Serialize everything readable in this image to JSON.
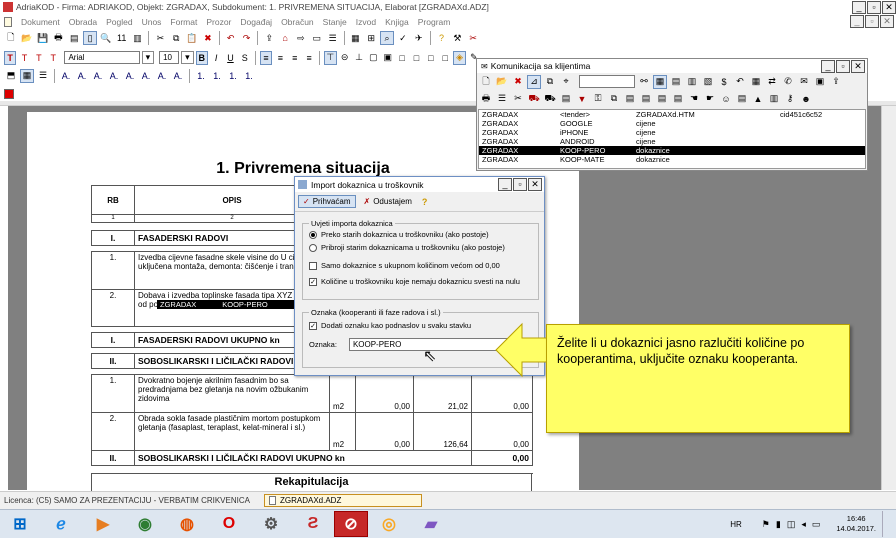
{
  "title": "AdriaKOD - Firma: ADRIAKOD,  Objekt: ZGRADAX,  Subdokument: 1. PRIVREMENA SITUACIJA,  Elaborat [ZGRADAXd.ADZ]",
  "menu": [
    "Dokument",
    "Obrada",
    "Pogled",
    "Unos",
    "Format",
    "Prozor",
    "Događaj",
    "Obračun",
    "Stanje",
    "Izvod",
    "Knjiga",
    "Program"
  ],
  "format": {
    "font": "Arial",
    "size": "10"
  },
  "doc": {
    "title": "1. Privremena situacija",
    "hdr": {
      "rb": "RB",
      "opis": "OPIS",
      "c1": "1",
      "c2": "2"
    },
    "s1": {
      "rb": "I.",
      "label": "FASADERSKI RADOVI"
    },
    "i1": {
      "rb": "1.",
      "text": "Izvedba cijevne fasadne skele visine do U cijenu uključena montaža, demonta: čišćenje i transport."
    },
    "i2": {
      "rb": "2.",
      "text": "Dobava i izvedba toplinske fasada tipa XYZ d=5 cm, od poliest. ploča EPS te privrušcice poliamidne",
      "ov1": "ZGRADAX",
      "ov2": "KOOP-PERO"
    },
    "t1": {
      "rb": "I.",
      "label": "FASADERSKI RADOVI UKUPNO kn"
    },
    "s2": {
      "rb": "II.",
      "label": "SOBOSLIKARSKI I LIČILAČKI RADOVI"
    },
    "i3": {
      "rb": "1.",
      "text": "Dvokratno bojenje akrilnim fasadnim bo sa predradnjama bez gletanja na novim ožbukanim zidovima",
      "unit": "m2",
      "a": "0,00",
      "b": "21,02",
      "c": "0,00"
    },
    "i4": {
      "rb": "2.",
      "text": "Obrada sokla fasade plastičnim mortom postupkom gletanja (fasaplast, teraplast, kelat-mineral i sl.)",
      "unit": "m2",
      "a": "0,00",
      "b": "126,64",
      "c": "0,00"
    },
    "t2": {
      "rb": "II.",
      "label": "SOBOSLIKARSKI I LIČILAČKI RADOVI UKUPNO kn",
      "total": "0,00"
    },
    "next": "Rekapitulacija"
  },
  "komm": {
    "title": "Komunikacija sa klijentima",
    "rows": [
      {
        "a": "ZGRADAX",
        "b": "<tender>",
        "c": "ZGRADAXd.HTM",
        "d": "cid451c6c52",
        "sel": false
      },
      {
        "a": "ZGRADAX",
        "b": "GOOGLE",
        "c": "cijene",
        "d": "",
        "sel": false
      },
      {
        "a": "ZGRADAX",
        "b": "iPHONE",
        "c": "cijene",
        "d": "",
        "sel": false
      },
      {
        "a": "ZGRADAX",
        "b": "ANDROID",
        "c": "cijene",
        "d": "",
        "sel": false
      },
      {
        "a": "ZGRADAX",
        "b": "KOOP-PERO",
        "c": "dokaznice",
        "d": "",
        "sel": true
      },
      {
        "a": "ZGRADAX",
        "b": "KOOP-MATE",
        "c": "dokaznice",
        "d": "",
        "sel": false
      }
    ]
  },
  "dlg": {
    "title": "Import dokaznica u troškovnik",
    "ok": "Prihvaćam",
    "cancel": "Odustajem",
    "g1": "Uvjeti importa dokaznica",
    "r1": "Preko starih dokaznica u troškovniku (ako postoje)",
    "r2": "Pribroji starim dokaznicama u troškovniku (ako postoje)",
    "c1": "Samo dokaznice s ukupnom količinom većom od 0,00",
    "c2": "Količine u troškovniku koje nemaju dokaznicu svesti na nulu",
    "g2": "Oznaka (kooperanti ili faze radova i sl.)",
    "c3": "Dodati oznaku kao podnaslov u svaku stavku",
    "lbl": "Oznaka:",
    "val": "KOOP-PERO"
  },
  "callout": "Želite li u dokaznici jasno razlučiti količine po kooperantima, uključite oznaku kooperanta.",
  "status": {
    "lic": "Licenca: (C5) SAMO ZA PREZENTACIJU - VERBATIM CRIKVENICA",
    "file": "ZGRADAXd.ADZ"
  },
  "tray": {
    "lang": "HR",
    "time": "16:46",
    "date": "14.04.2017."
  }
}
